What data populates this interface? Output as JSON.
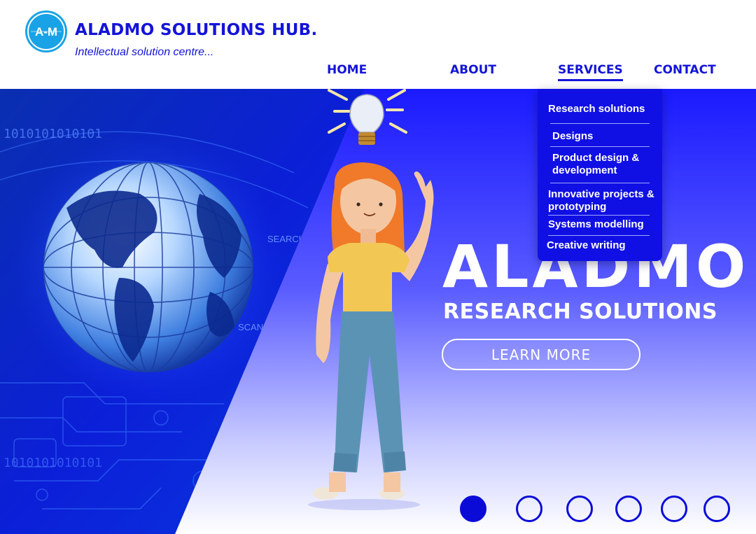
{
  "brand": {
    "logo_text": "A-M",
    "name": "ALADMO SOLUTIONS HUB.",
    "tagline": "Intellectual solution centre..."
  },
  "nav": {
    "items": [
      {
        "label": "HOME"
      },
      {
        "label": "ABOUT"
      },
      {
        "label": "SERVICES",
        "active": true
      },
      {
        "label": "CONTACT"
      }
    ]
  },
  "services_menu": {
    "items": [
      {
        "label": "Research solutions"
      },
      {
        "label": "Designs"
      },
      {
        "label": "Product design & development"
      },
      {
        "label": "Innovative projects & prototyping"
      },
      {
        "label": "Systems modelling"
      },
      {
        "label": "Creative writing"
      }
    ]
  },
  "hero": {
    "title": "ALADMO",
    "subtitle": "RESEARCH SOLUTIONS",
    "cta_label": "LEARN MORE",
    "bg_labels": {
      "search": "SEARCH",
      "scan": "SCANN"
    },
    "binary_text": "1010101010101",
    "slide_count": 6,
    "active_slide": 1
  },
  "colors": {
    "brand_blue": "#1414d9",
    "hero_blue": "#1a1aff",
    "logo_cyan": "#19a3e6",
    "hair": "#f07a2a",
    "shirt": "#f3c754",
    "jeans": "#5b93b5"
  }
}
